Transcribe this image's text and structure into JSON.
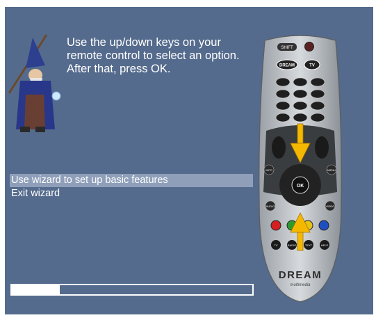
{
  "wizard": {
    "instruction": "Use the up/down keys on your remote control to select an option. After that, press OK."
  },
  "menu": {
    "items": [
      {
        "label": "Use wizard to set up basic features",
        "selected": true
      },
      {
        "label": "Exit wizard",
        "selected": false
      }
    ]
  },
  "progress": {
    "fraction": 0.2
  },
  "remote": {
    "shift_label": "SHIFT",
    "dream_label": "DREAM",
    "tv_label": "TV",
    "ok_label": "OK",
    "info_label": "INFO",
    "menu_label": "MENU",
    "audio_label": "AUDIO",
    "video_label": "VIDEO",
    "tv_btn_label": "TV",
    "radio_label": "RADIO",
    "text_label": "TEXT",
    "help_label": "HELP",
    "brand": "DREAM",
    "brand_sub": "multimedia",
    "color_buttons": [
      "#d42020",
      "#2e9a2e",
      "#e3c21a",
      "#2050c0"
    ],
    "arrow_color": "#f5b800"
  }
}
